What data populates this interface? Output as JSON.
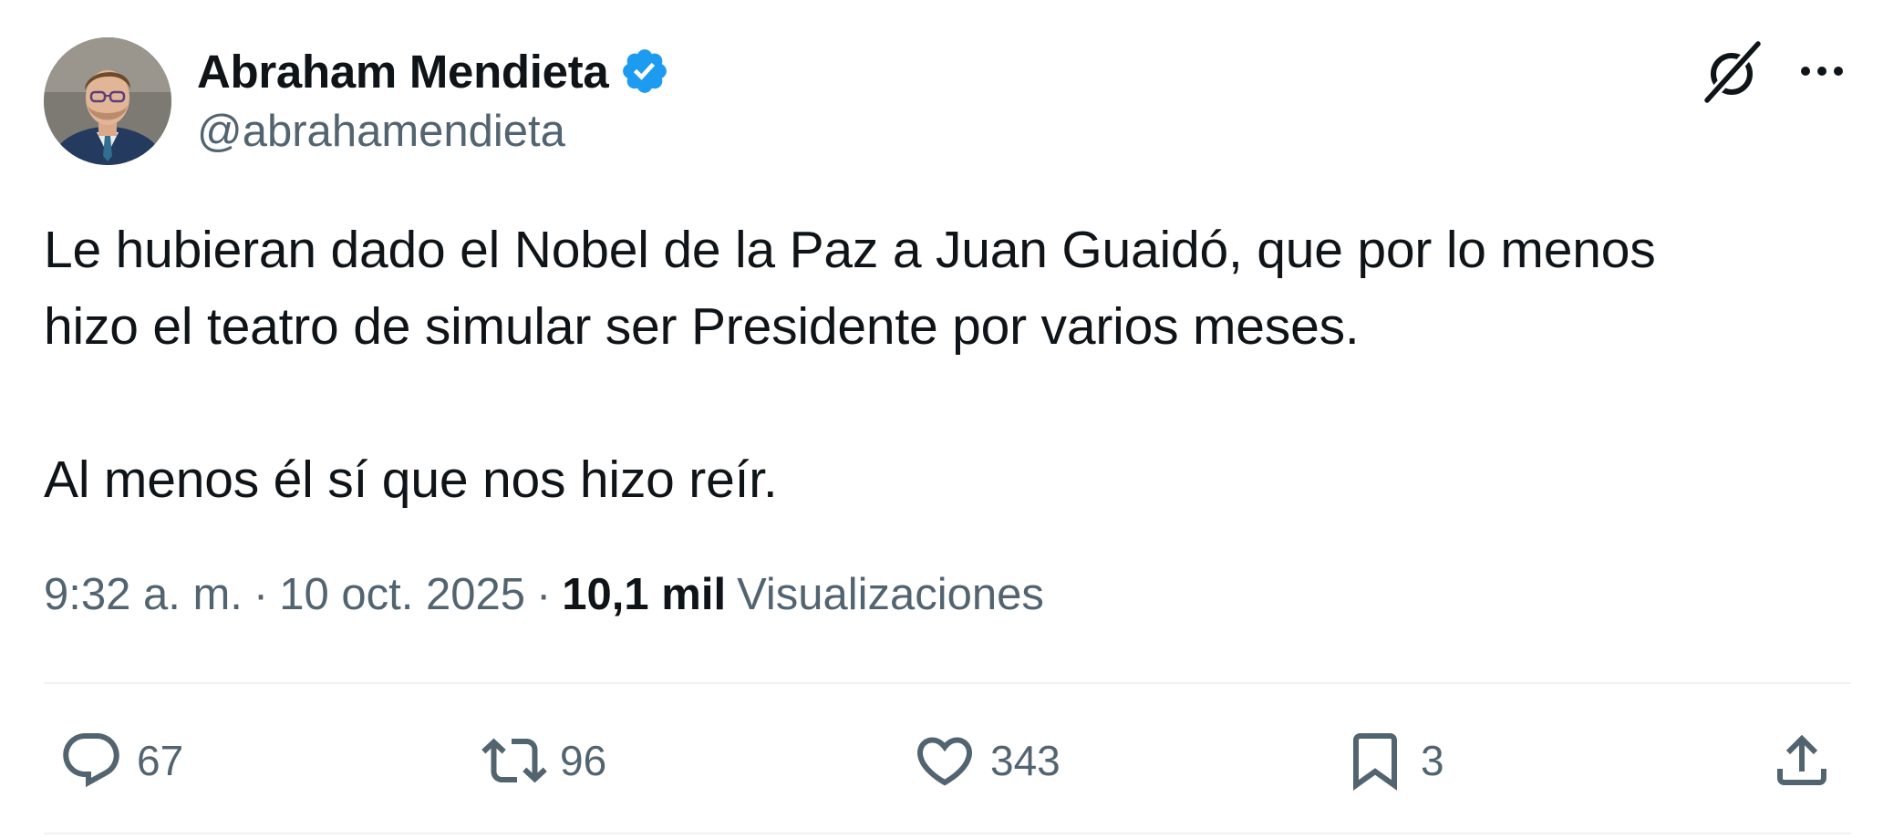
{
  "author": {
    "display_name": "Abraham Mendieta",
    "handle": "@abrahamendieta",
    "verified": true,
    "verified_color": "#1d9bf0"
  },
  "tweet": {
    "lines": [
      "Le hubieran dado el Nobel de la Paz a Juan Guaidó, que por lo menos",
      "hizo el teatro de simular ser Presidente por varios meses.",
      "Al menos él sí que nos hizo reír."
    ]
  },
  "meta": {
    "time": "9:32 a. m.",
    "separator": "·",
    "date": "10 oct. 2025",
    "views_count": "10,1 mil",
    "views_label": "Visualizaciones"
  },
  "actions": {
    "reply": {
      "icon": "reply-icon",
      "count": "67"
    },
    "retweet": {
      "icon": "retweet-icon",
      "count": "96"
    },
    "like": {
      "icon": "heart-icon",
      "count": "343"
    },
    "bookmark": {
      "icon": "bookmark-icon",
      "count": "3"
    },
    "share": {
      "icon": "share-icon"
    }
  },
  "header_icons": [
    "grok-icon",
    "more-icon"
  ],
  "colors": {
    "text": "#0f1419",
    "secondary": "#536471",
    "divider": "#eff3f4",
    "background": "#ffffff"
  }
}
